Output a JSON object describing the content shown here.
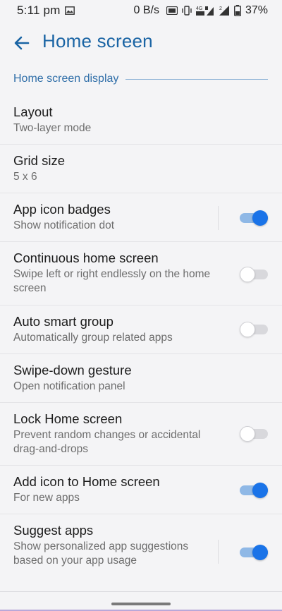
{
  "status_bar": {
    "time": "5:11 pm",
    "speed": "0 B/s",
    "battery_percent": "37%"
  },
  "header": {
    "title": "Home screen"
  },
  "section": {
    "title": "Home screen display"
  },
  "settings": [
    {
      "title": "Layout",
      "subtitle": "Two-layer mode"
    },
    {
      "title": "Grid size",
      "subtitle": "5 x 6"
    },
    {
      "title": "App icon badges",
      "subtitle": "Show notification dot",
      "toggle": "on"
    },
    {
      "title": "Continuous home screen",
      "subtitle": "Swipe left or right endlessly on the home screen",
      "toggle": "off"
    },
    {
      "title": "Auto smart group",
      "subtitle": "Automatically group related apps",
      "toggle": "off"
    },
    {
      "title": "Swipe-down gesture",
      "subtitle": "Open notification panel"
    },
    {
      "title": "Lock Home screen",
      "subtitle": "Prevent random changes or accidental drag-and-drops",
      "toggle": "off"
    },
    {
      "title": "Add icon to Home screen",
      "subtitle": "For new apps",
      "toggle": "on"
    },
    {
      "title": "Suggest apps",
      "subtitle": "Show personalized app suggestions based on your app usage",
      "toggle": "on"
    }
  ],
  "colors": {
    "accent": "#1a64a4",
    "toggle_on": "#1a73e8",
    "background": "#f4f4f6"
  }
}
